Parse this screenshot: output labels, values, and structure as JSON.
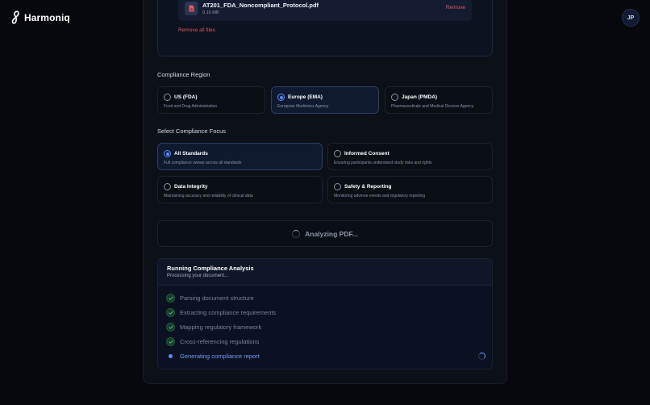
{
  "app": {
    "name": "Harmoniq",
    "user_initials": "JP"
  },
  "upload": {
    "file_name": "AT201_FDA_Noncompliant_Protocol.pdf",
    "file_size": "0.16 MB",
    "remove_label": "Remove",
    "remove_all_label": "Remove all files"
  },
  "region": {
    "title": "Compliance Region",
    "selected": "Europe (EMA)",
    "options": [
      {
        "label": "US (FDA)",
        "desc": "Food and Drug Administration",
        "selected": false
      },
      {
        "label": "Europe (EMA)",
        "desc": "European Medicines Agency",
        "selected": true
      },
      {
        "label": "Japan (PMDA)",
        "desc": "Pharmaceuticals and Medical Devices Agency",
        "selected": false
      }
    ]
  },
  "focus": {
    "title": "Select Compliance Focus",
    "selected": "All Standards",
    "options": [
      {
        "label": "All Standards",
        "desc": "Full compliance sweep across all standards",
        "selected": true
      },
      {
        "label": "Informed Consent",
        "desc": "Ensuring participants understand study risks and rights",
        "selected": false
      },
      {
        "label": "Data Integrity",
        "desc": "Maintaining accuracy and reliability of clinical data",
        "selected": false
      },
      {
        "label": "Safety & Reporting",
        "desc": "Monitoring adverse events and regulatory reporting",
        "selected": false
      }
    ]
  },
  "analyze": {
    "label": "Analyzing PDF..."
  },
  "progress": {
    "title": "Running Compliance Analysis",
    "subtitle": "Processing your document...",
    "steps": [
      {
        "label": "Parsing document structure",
        "status": "done"
      },
      {
        "label": "Extracting compliance requirements",
        "status": "done"
      },
      {
        "label": "Mapping regulatory framework",
        "status": "done"
      },
      {
        "label": "Cross-referencing regulations",
        "status": "done"
      },
      {
        "label": "Generating compliance report",
        "status": "active"
      }
    ]
  },
  "colors": {
    "accent": "#5b8cff",
    "danger": "#e05b5b",
    "success": "#3ec27a",
    "background": "#06080d"
  }
}
